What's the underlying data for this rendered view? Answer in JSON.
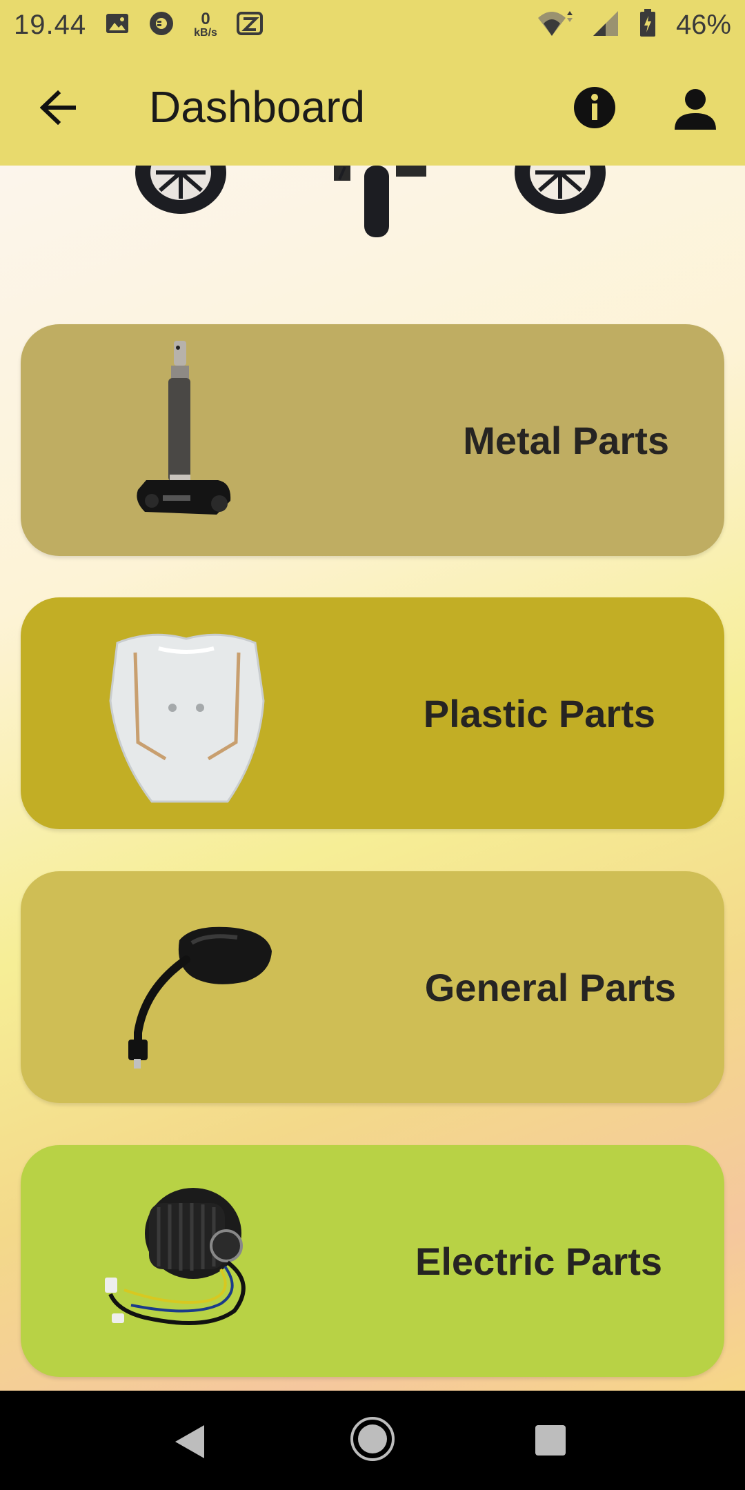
{
  "status_bar": {
    "time": "19.44",
    "net_speed_value": "0",
    "net_speed_unit": "kB/s",
    "battery_percent": "46%"
  },
  "app_bar": {
    "title": "Dashboard"
  },
  "categories": [
    {
      "label": "Metal Parts",
      "bg": "#bfad62",
      "icon": "steering-stem-image"
    },
    {
      "label": "Plastic Parts",
      "bg": "#c2ae25",
      "icon": "plastic-fairing-image"
    },
    {
      "label": "General Parts",
      "bg": "#cfbe55",
      "icon": "mirror-image"
    },
    {
      "label": "Electric Parts",
      "bg": "#b8d245",
      "icon": "motor-image"
    }
  ],
  "colors": {
    "app_bar": "#e8da6d",
    "nav_bar": "#000000"
  }
}
